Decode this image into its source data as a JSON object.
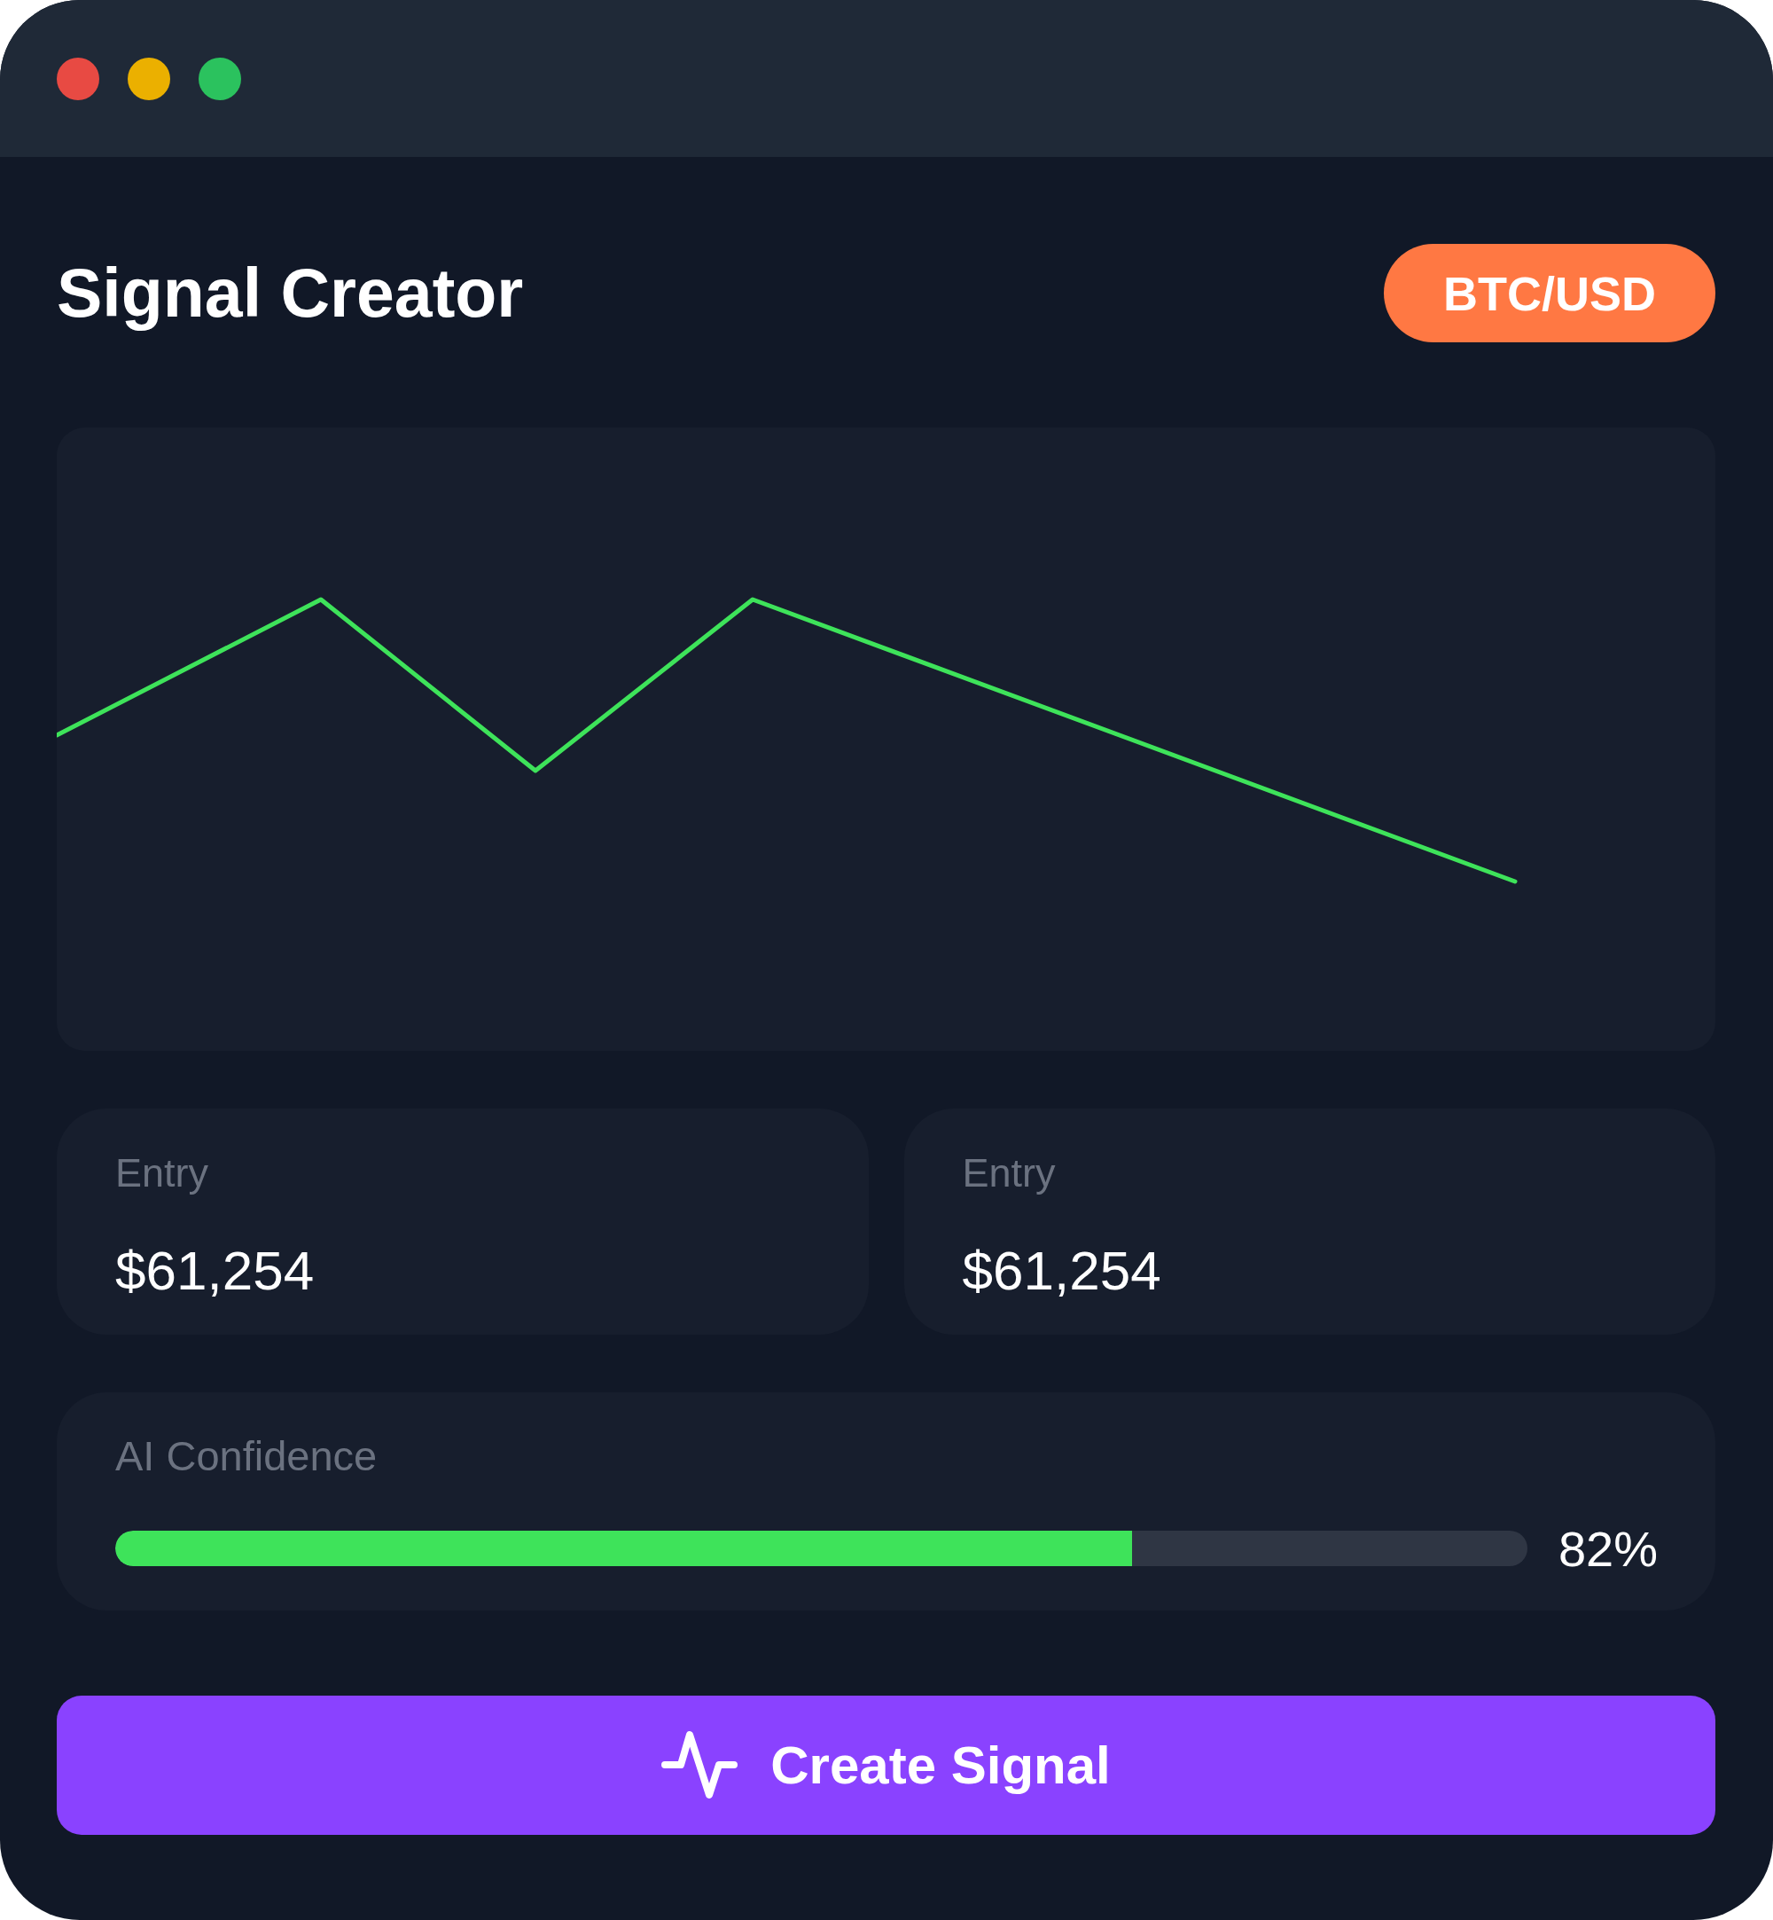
{
  "window": {
    "controls": [
      {
        "color": "#e84a43"
      },
      {
        "color": "#ebb000"
      },
      {
        "color": "#2bc25e"
      }
    ]
  },
  "header": {
    "title": "Signal Creator",
    "pair": "BTC/USD"
  },
  "stats": [
    {
      "label": "Entry",
      "value": "$61,254"
    },
    {
      "label": "Entry",
      "value": "$61,254"
    }
  ],
  "confidence": {
    "label": "AI Confidence",
    "level": 0.72,
    "reading": "82%"
  },
  "action": {
    "label": "Create Signal"
  }
}
